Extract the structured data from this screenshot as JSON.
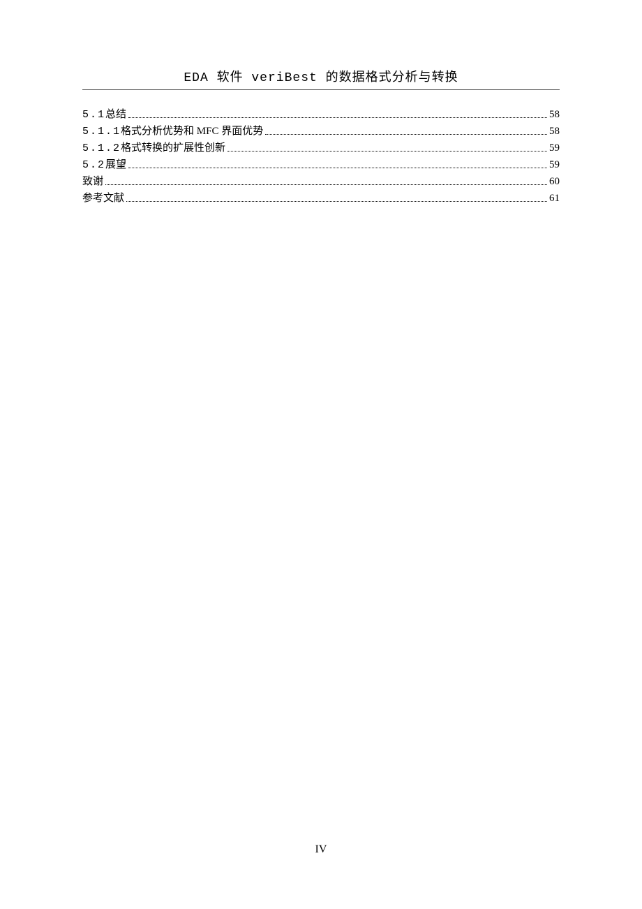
{
  "header": {
    "title": "EDA 软件 veriBest 的数据格式分析与转换"
  },
  "toc": {
    "entries": [
      {
        "num": "5.1 ",
        "label": " 总结",
        "page": "58"
      },
      {
        "num": "5.1.1 ",
        "label": "格式分析优势和 MFC 界面优势",
        "page": "58"
      },
      {
        "num": "5.1.2 ",
        "label": "格式转换的扩展性创新",
        "page": "59"
      },
      {
        "num": "5.2 ",
        "label": " 展望",
        "page": "59"
      },
      {
        "num": "",
        "label": "致谢",
        "page": "60"
      },
      {
        "num": "",
        "label": "参考文献",
        "page": "61"
      }
    ]
  },
  "footer": {
    "page_number": "IV"
  }
}
